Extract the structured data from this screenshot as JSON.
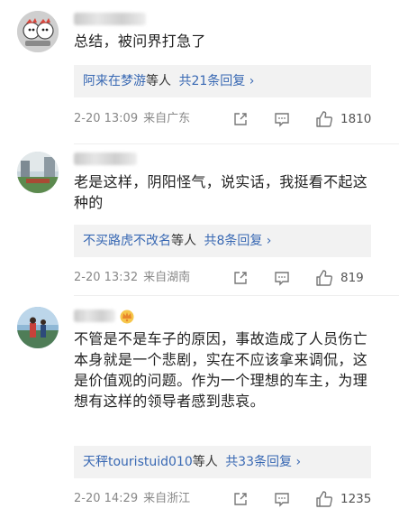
{
  "comments": [
    {
      "text": "总结，被问界打急了",
      "reply_names": "阿来在梦游",
      "reply_mid": "等人",
      "reply_count": "共21条回复 ›",
      "time": "2-20 13:09",
      "location": "来自广东",
      "likes": "1810"
    },
    {
      "text": "老是这样，阴阳怪气，说实话，我挺看不起这种的",
      "reply_names": "不买路虎不改名",
      "reply_mid": "等人",
      "reply_count": "共8条回复 ›",
      "time": "2-20 13:32",
      "location": "来自湖南",
      "likes": "819"
    },
    {
      "text": "不管是不是车子的原因，事故造成了人员伤亡本身就是一个悲剧，实在不应该拿来调侃，这是价值观的问题。作为一个理想的车主，为理想有这样的领导者感到悲哀。",
      "reply_names": "天秤touristuid010",
      "reply_mid": "等人",
      "reply_count": "共33条回复 ›",
      "time": "2-20 14:29",
      "location": "来自浙江",
      "likes": "1235"
    }
  ],
  "icons": {
    "share": "share-icon",
    "comment": "comment-icon",
    "like": "thumbs-up-icon",
    "badge": "crown-badge-icon"
  },
  "colors": {
    "link_blue": "#3868b3",
    "meta_gray": "#888888",
    "reply_bg": "#f2f2f2"
  }
}
